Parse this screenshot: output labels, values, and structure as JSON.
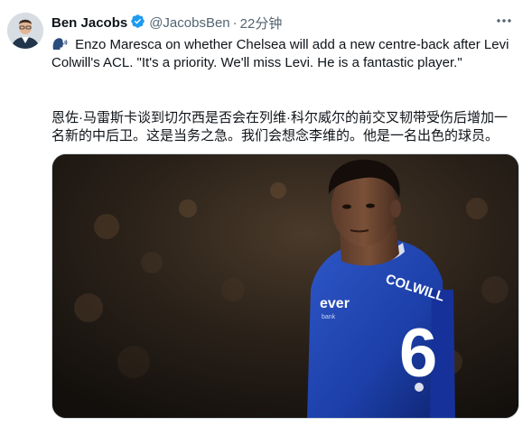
{
  "author": {
    "name": "Ben Jacobs",
    "handle": "@JacobsBen",
    "separator": "·",
    "time": "22分钟"
  },
  "tweet": {
    "english_line1": "Enzo Maresca on whether Chelsea will add a new centre-back after Levi",
    "english_line2": "Colwill's ACL. \"It's a priority. We'll miss Levi. He is a fantastic player.\"",
    "translation_line1": "恩佐·马雷斯卡谈到切尔西是否会在列维·科尔威尔的前交叉韧带受伤后增加一",
    "translation_line2": "名新的中后卫。这是当务之急。我们会想念李维的。他是一名出色的球员。"
  },
  "media": {
    "jersey_name": "COLWILL",
    "jersey_number": "6",
    "sponsor": "ever",
    "sponsor_sub": "bank"
  },
  "colors": {
    "verified": "#1d9bf0",
    "text": "#0f1419",
    "secondary": "#536471",
    "jersey": "#1c3fa8"
  },
  "icons": [
    "verified-badge-icon",
    "more-options-icon",
    "speaking-head-emoji-icon"
  ]
}
